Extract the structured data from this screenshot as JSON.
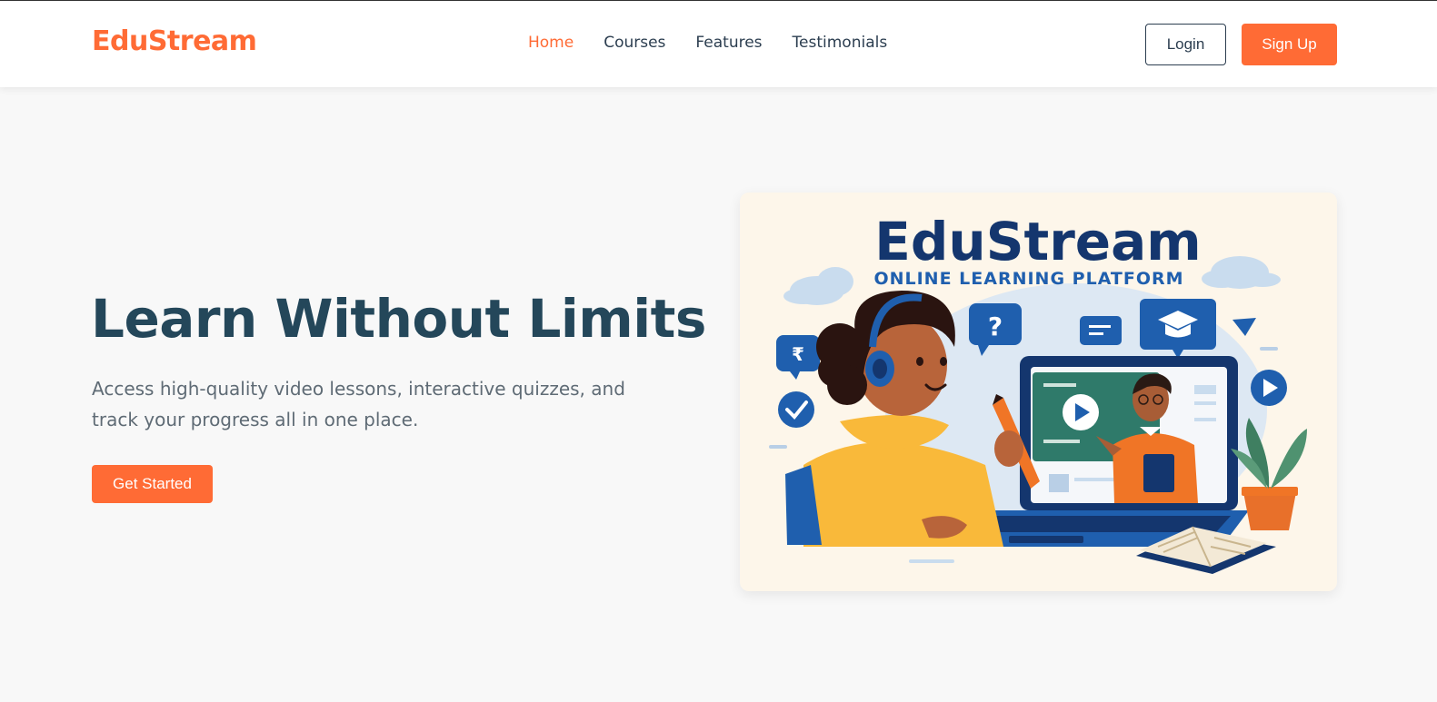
{
  "brand": {
    "name": "EduStream",
    "color": "#ff6b35"
  },
  "nav": {
    "items": [
      {
        "label": "Home",
        "active": true
      },
      {
        "label": "Courses",
        "active": false
      },
      {
        "label": "Features",
        "active": false
      },
      {
        "label": "Testimonials",
        "active": false
      }
    ]
  },
  "auth": {
    "login_label": "Login",
    "signup_label": "Sign Up"
  },
  "hero": {
    "title": "Learn Without Limits",
    "subtitle": "Access high-quality video lessons, interactive quizzes, and track your progress all in one place.",
    "cta_label": "Get Started"
  },
  "illustration": {
    "title": "EduStream",
    "tagline": "ONLINE LEARNING PLATFORM"
  },
  "colors": {
    "accent": "#ff6b35",
    "heading": "#24475a",
    "illustration_blue": "#1f5fae",
    "illustration_navy": "#14366e"
  }
}
